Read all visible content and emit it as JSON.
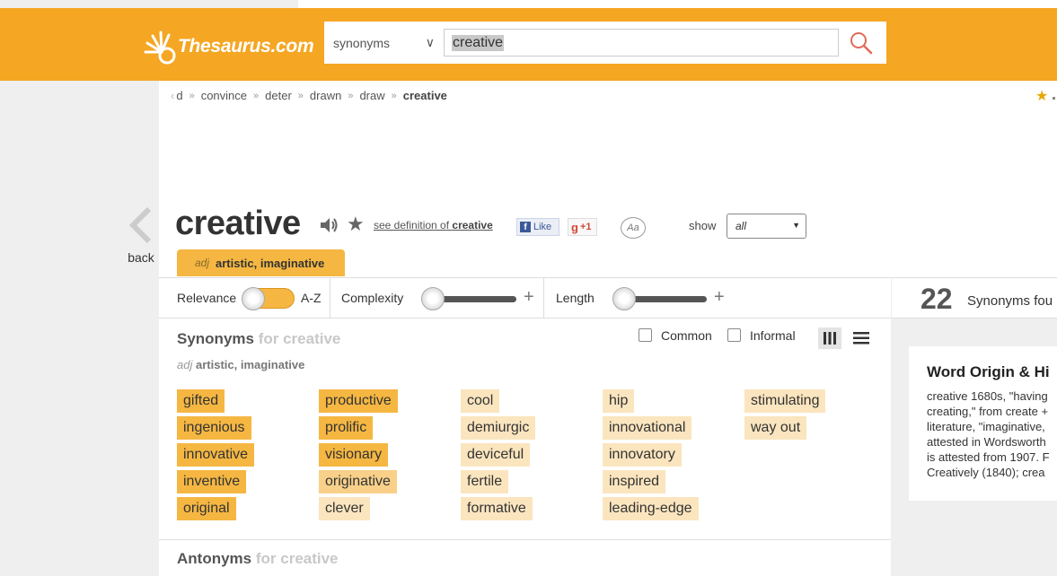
{
  "header": {
    "logo_text": "Thesaurus.com",
    "search": {
      "category": "synonyms",
      "query": "creative"
    }
  },
  "breadcrumb": {
    "items": [
      "d",
      "convince",
      "deter",
      "drawn",
      "draw"
    ],
    "current": "creative"
  },
  "back_label": "back",
  "word": {
    "title": "creative",
    "see_def_prefix": "see definition of",
    "see_def_word": "creative",
    "fb_like": "Like",
    "gplus": "+1",
    "font_icon": "Aa",
    "show_label": "show",
    "show_value": "all"
  },
  "sense_tab": {
    "pos": "adj",
    "definition": "artistic, imaginative"
  },
  "filters": {
    "relevance": "Relevance",
    "az": "A-Z",
    "complexity": "Complexity",
    "length": "Length"
  },
  "synonyms": {
    "heading": "Synonyms",
    "for_text": "for creative",
    "sub_pos": "adj",
    "sub_def": "artistic, imaginative",
    "common_label": "Common",
    "informal_label": "Informal",
    "columns": [
      [
        {
          "word": "gifted",
          "rel": 3
        },
        {
          "word": "ingenious",
          "rel": 3
        },
        {
          "word": "innovative",
          "rel": 3
        },
        {
          "word": "inventive",
          "rel": 3
        },
        {
          "word": "original",
          "rel": 3
        }
      ],
      [
        {
          "word": "productive",
          "rel": 3
        },
        {
          "word": "prolific",
          "rel": 3
        },
        {
          "word": "visionary",
          "rel": 3
        },
        {
          "word": "originative",
          "rel": 2
        },
        {
          "word": "clever",
          "rel": 1
        }
      ],
      [
        {
          "word": "cool",
          "rel": 1
        },
        {
          "word": "demiurgic",
          "rel": 1
        },
        {
          "word": "deviceful",
          "rel": 1
        },
        {
          "word": "fertile",
          "rel": 1
        },
        {
          "word": "formative",
          "rel": 1
        }
      ],
      [
        {
          "word": "hip",
          "rel": 1
        },
        {
          "word": "innovational",
          "rel": 1
        },
        {
          "word": "innovatory",
          "rel": 1
        },
        {
          "word": "inspired",
          "rel": 1
        },
        {
          "word": "leading-edge",
          "rel": 1
        }
      ],
      [
        {
          "word": "stimulating",
          "rel": 1
        },
        {
          "word": "way out",
          "rel": 1
        }
      ]
    ]
  },
  "antonyms": {
    "heading": "Antonyms",
    "for_text": "for creative"
  },
  "right_panel": {
    "count": "22",
    "found_text": "Synonyms fou",
    "origin_title": "Word Origin & Hi",
    "origin_lines": [
      "creative 1680s, \"having",
      "creating,\" from create +",
      "literature, \"imaginative,",
      "attested in Wordsworth",
      "is attested from 1907. F",
      "Creatively (1840); crea"
    ]
  },
  "colors": {
    "brand_orange": "#f5a623",
    "relevance_high": "#f5b742",
    "relevance_mid": "#f8d089",
    "relevance_low": "#fbe5be"
  }
}
